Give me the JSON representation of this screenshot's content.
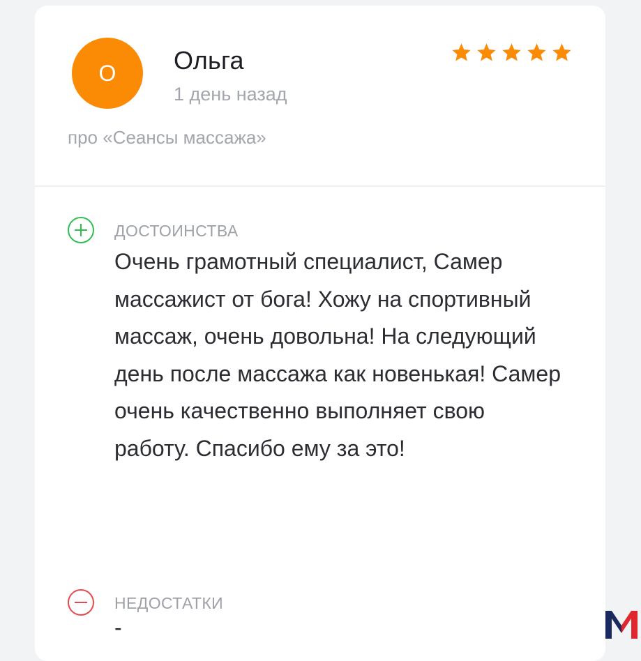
{
  "review": {
    "author": {
      "initial": "О",
      "name": "Ольга",
      "avatar_color": "#fb8a05"
    },
    "date": "1 день назад",
    "rating": 5,
    "rating_max": 5,
    "star_color": "#fb8a05",
    "service": "про «Сеансы массажа»",
    "pros": {
      "title": "ДОСТОИНСТВА",
      "icon": "plus-circle-icon",
      "icon_color": "#2fbf4f",
      "text": "Очень грамотный специалист, Самер массажист от бога! Хожу на спортивный массаж, очень довольна! На следующий день после массажа как новенькая! Самер очень качественно выполняет свою работу. Спасибо ему за это!"
    },
    "cons": {
      "title": "НЕДОСТАТКИ",
      "icon": "minus-circle-icon",
      "icon_color": "#e5484d",
      "text": "-"
    }
  },
  "watermark": {
    "icon": "m-logo-icon",
    "colors": [
      "#1b2a5e",
      "#e0262e"
    ]
  }
}
